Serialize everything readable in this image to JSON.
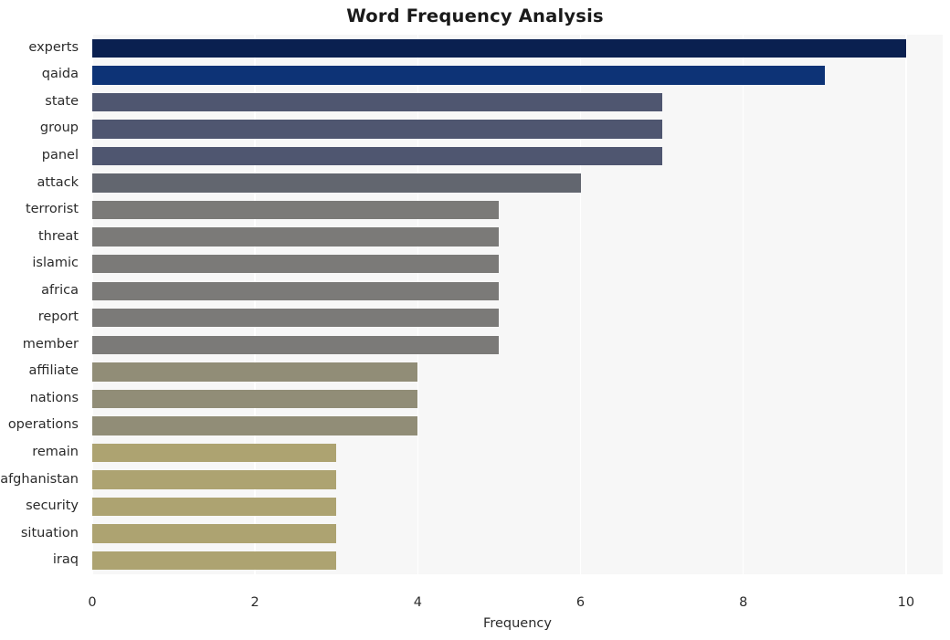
{
  "chart_data": {
    "type": "bar",
    "orientation": "horizontal",
    "title": "Word Frequency Analysis",
    "xlabel": "Frequency",
    "ylabel": "",
    "xlim": [
      0,
      10.45
    ],
    "xticks": [
      0,
      2,
      4,
      6,
      8,
      10
    ],
    "xtick_labels": [
      "0",
      "2",
      "4",
      "6",
      "8",
      "10"
    ],
    "grid": "vertical-white",
    "legend": "none",
    "background": "#f7f7f7",
    "categories": [
      "experts",
      "qaida",
      "state",
      "group",
      "panel",
      "attack",
      "terrorist",
      "threat",
      "islamic",
      "africa",
      "report",
      "member",
      "affiliate",
      "nations",
      "operations",
      "remain",
      "afghanistan",
      "security",
      "situation",
      "iraq"
    ],
    "values": [
      10,
      9,
      7,
      7,
      7,
      6,
      5,
      5,
      5,
      5,
      5,
      5,
      4,
      4,
      4,
      3,
      3,
      3,
      3,
      3
    ],
    "bar_colors": [
      "#0a2050",
      "#0d3376",
      "#4f5670",
      "#4f5670",
      "#4f5670",
      "#62666f",
      "#7b7a78",
      "#7b7a78",
      "#7b7a78",
      "#7b7a78",
      "#7b7a78",
      "#7b7a78",
      "#918d77",
      "#918d77",
      "#918d77",
      "#ada371",
      "#ada371",
      "#ada371",
      "#ada371",
      "#ada371"
    ]
  }
}
